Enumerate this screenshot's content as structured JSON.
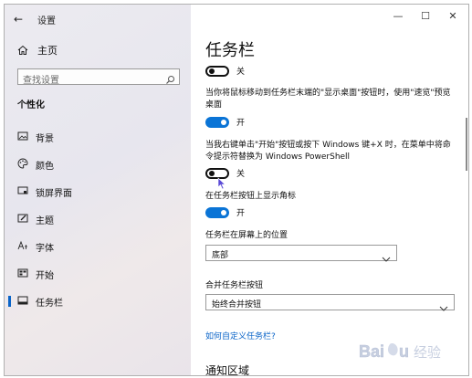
{
  "window": {
    "app_title": "设置",
    "controls": {
      "minimize": "—",
      "maximize": "☐",
      "close": "✕"
    }
  },
  "sidebar": {
    "home_label": "主页",
    "search_placeholder": "查找设置",
    "section_heading": "个性化",
    "items": [
      {
        "label": "背景",
        "icon": "picture-icon"
      },
      {
        "label": "颜色",
        "icon": "palette-icon"
      },
      {
        "label": "锁屏界面",
        "icon": "lockscreen-icon"
      },
      {
        "label": "主题",
        "icon": "brush-icon"
      },
      {
        "label": "字体",
        "icon": "font-icon"
      },
      {
        "label": "开始",
        "icon": "start-icon"
      },
      {
        "label": "任务栏",
        "icon": "taskbar-icon",
        "selected": true
      }
    ]
  },
  "main": {
    "title": "任务栏",
    "toggle1": {
      "state": "关"
    },
    "desc_peek": "当你将鼠标移动到任务栏末端的\"显示桌面\"按钮时，使用\"速览\"预览桌面",
    "toggle2": {
      "state": "开"
    },
    "desc_powershell": "当我右键单击\"开始\"按钮或按下 Windows 键+X 时，在菜单中将命令提示符替换为 Windows PowerShell",
    "toggle3": {
      "state": "关"
    },
    "badges_label": "在任务栏按钮上显示角标",
    "toggle4": {
      "state": "开"
    },
    "position_label": "任务栏在屏幕上的位置",
    "position_value": "底部",
    "combine_label": "合并任务栏按钮",
    "combine_value": "始终合并按钮",
    "customize_link": "如何自定义任务栏?",
    "next_section": "通知区域"
  },
  "watermark": {
    "text": "Baidu 经验"
  },
  "colors": {
    "accent": "#0a74d6",
    "link": "#0a64c8"
  }
}
